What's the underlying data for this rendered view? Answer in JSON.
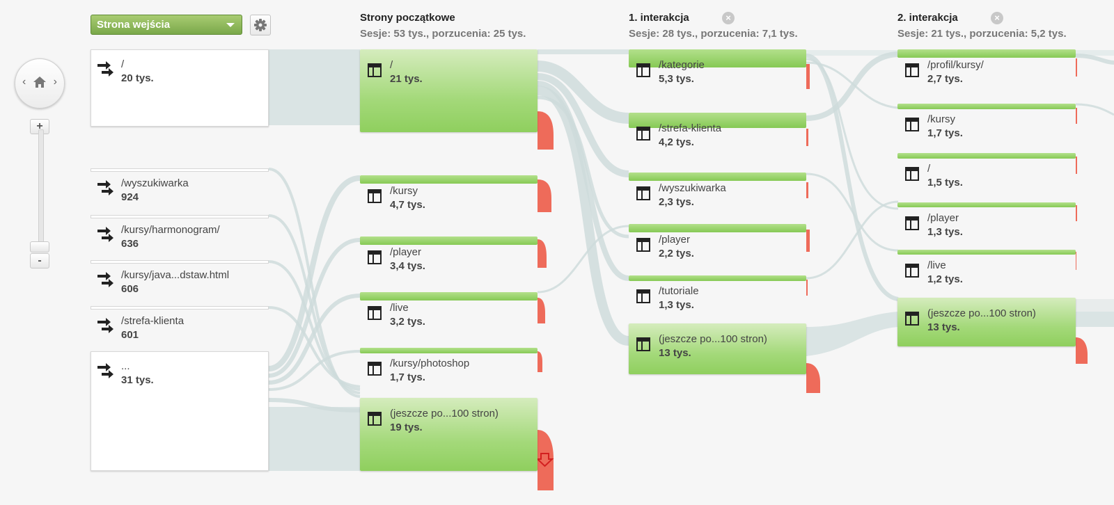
{
  "toolbar": {
    "dropdown_label": "Strona wejścia"
  },
  "columns": [
    {
      "title": "Strony początkowe",
      "summary": "Sesje: 53 tys., porzucenia: 25 tys."
    },
    {
      "title": "1. interakcja",
      "summary": "Sesje: 28 tys., porzucenia: 7,1 tys."
    },
    {
      "title": "2. interakcja",
      "summary": "Sesje: 21 tys., porzucenia: 5,2 tys."
    }
  ],
  "zoom": {
    "plus": "+",
    "minus": "-"
  },
  "nav": {
    "left": "‹",
    "right": "›"
  },
  "entry_pages": [
    {
      "label": "/",
      "value": "20 tys."
    },
    {
      "label": "/wyszukiwarka",
      "value": "924"
    },
    {
      "label": "/kursy/harmonogram/",
      "value": "636"
    },
    {
      "label": "/kursy/java...dstaw.html",
      "value": "606"
    },
    {
      "label": "/strefa-klienta",
      "value": "601"
    },
    {
      "label": "...",
      "value": "31 tys."
    }
  ],
  "starting_pages": [
    {
      "label": "/",
      "value": "21 tys."
    },
    {
      "label": "/kursy",
      "value": "4,7 tys."
    },
    {
      "label": "/player",
      "value": "3,4 tys."
    },
    {
      "label": "/live",
      "value": "3,2 tys."
    },
    {
      "label": "/kursy/photoshop",
      "value": "1,7 tys."
    },
    {
      "label": "(jeszcze po...100 stron)",
      "value": "19 tys."
    }
  ],
  "first_interaction": [
    {
      "label": "/kategorie",
      "value": "5,3 tys."
    },
    {
      "label": "/strefa-klienta",
      "value": "4,2 tys."
    },
    {
      "label": "/wyszukiwarka",
      "value": "2,3 tys."
    },
    {
      "label": "/player",
      "value": "2,2 tys."
    },
    {
      "label": "/tutoriale",
      "value": "1,3 tys."
    },
    {
      "label": "(jeszcze po...100 stron)",
      "value": "13 tys."
    }
  ],
  "second_interaction": [
    {
      "label": "/profil/kursy/",
      "value": "2,7 tys."
    },
    {
      "label": "/kursy",
      "value": "1,7 tys."
    },
    {
      "label": "/",
      "value": "1,5 tys."
    },
    {
      "label": "/player",
      "value": "1,3 tys."
    },
    {
      "label": "/live",
      "value": "1,2 tys."
    },
    {
      "label": "(jeszcze po...100 stron)",
      "value": "13 tys."
    }
  ],
  "colors": {
    "node_green": "#8fcf5e",
    "dropoff_red": "#ee6b5a",
    "flow": "#d4e0e0",
    "dropdown_green": "#7aa84a"
  }
}
